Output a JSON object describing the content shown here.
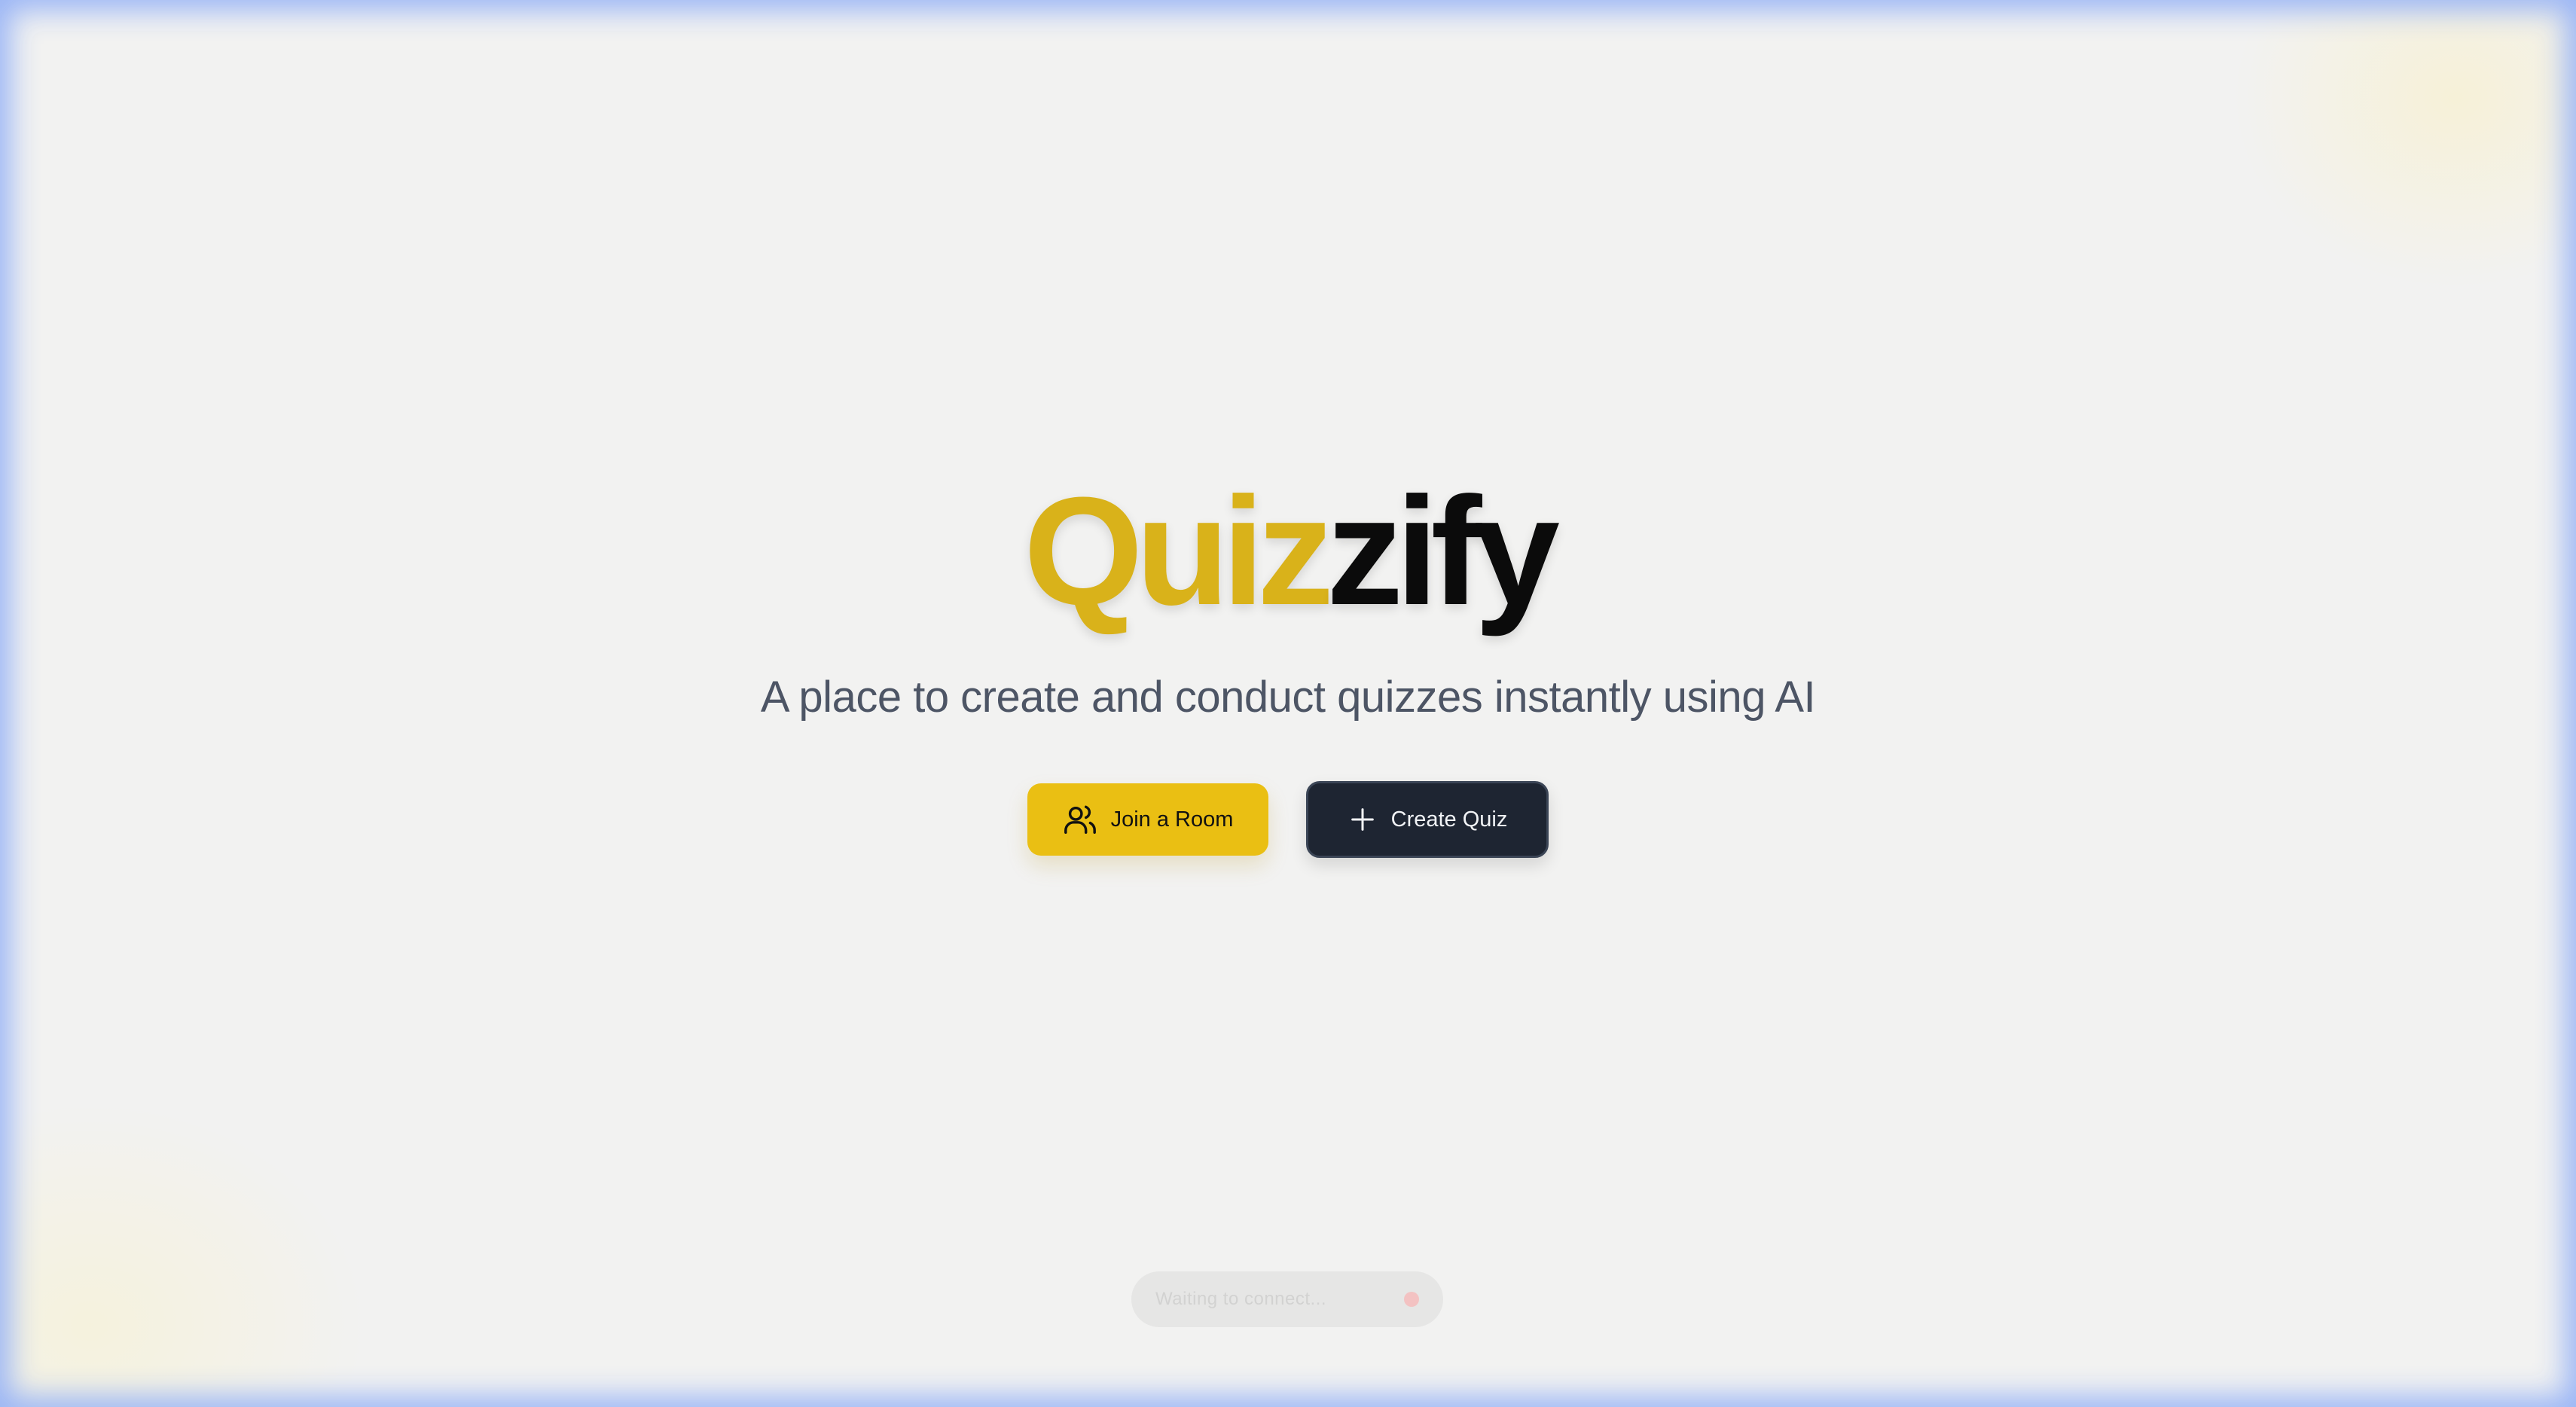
{
  "logo": {
    "part1": "Quiz",
    "part2": "zify"
  },
  "hero": {
    "tagline": "A place to create and conduct quizzes instantly using AI"
  },
  "actions": {
    "join_label": "Join a Room",
    "create_label": "Create Quiz"
  },
  "toast": {
    "text": "Waiting to connect..."
  },
  "colors": {
    "brand_gold": "#d9b21a",
    "join_button": "#eabf13",
    "create_button": "#1e2532",
    "frame_glow": "#96b2f5"
  },
  "icons": {
    "join": "users-icon",
    "create": "plus-icon"
  }
}
